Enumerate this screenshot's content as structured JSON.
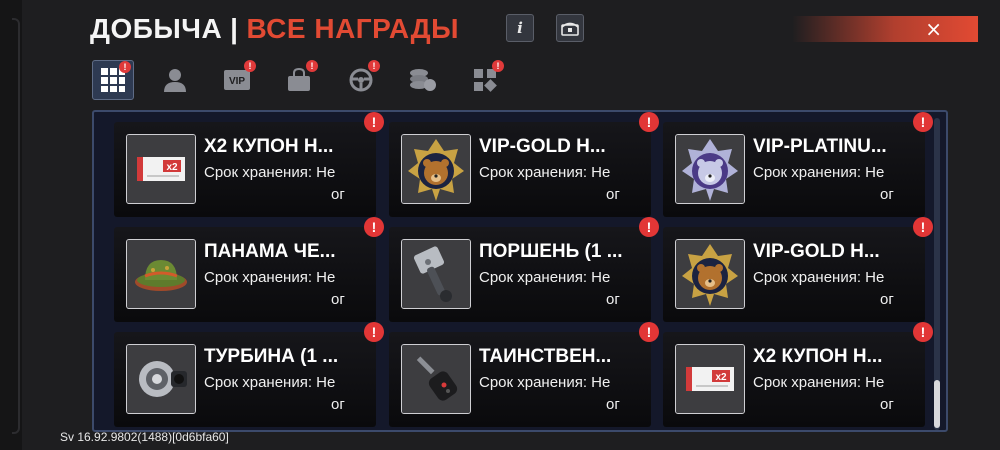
{
  "header": {
    "title_main": "ДОБЫЧА",
    "title_sep": "|",
    "title_accent": "ВСЕ НАГРАДЫ",
    "info_button_label": "i",
    "close_label": "×",
    "accent_color": "#e24a33"
  },
  "tabs": [
    {
      "icon": "grid-icon",
      "active": true,
      "badge": "!"
    },
    {
      "icon": "person-icon",
      "active": false,
      "badge": ""
    },
    {
      "icon": "vip-icon",
      "label": "VIP",
      "active": false,
      "badge": "!"
    },
    {
      "icon": "bag-icon",
      "active": false,
      "badge": "!"
    },
    {
      "icon": "steering-wheel-icon",
      "active": false,
      "badge": "!"
    },
    {
      "icon": "coins-icon",
      "active": false,
      "badge": ""
    },
    {
      "icon": "apps-icon",
      "active": false,
      "badge": "!"
    }
  ],
  "items": [
    {
      "name": "X2 КУПОН Н...",
      "storage": "Срок хранения: Не",
      "storage_cont": "ог",
      "icon": "x2-coupon-icon",
      "badge": "!"
    },
    {
      "name": "VIP-GOLD Н...",
      "storage": "Срок хранения: Не",
      "storage_cont": "ог",
      "icon": "vip-gold-bear-icon",
      "badge": "!"
    },
    {
      "name": "VIP-PLATINU...",
      "storage": "Срок хранения: Не",
      "storage_cont": "ог",
      "icon": "vip-platinum-bear-icon",
      "badge": "!"
    },
    {
      "name": "ПАНАМА ЧЕ...",
      "storage": "Срок хранения: Не",
      "storage_cont": "ог",
      "icon": "panama-hat-icon",
      "badge": "!"
    },
    {
      "name": "ПОРШЕНЬ (1 ...",
      "storage": "Срок хранения: Не",
      "storage_cont": "ог",
      "icon": "piston-icon",
      "badge": "!"
    },
    {
      "name": "VIP-GOLD Н...",
      "storage": "Срок хранения: Не",
      "storage_cont": "ог",
      "icon": "vip-gold-bear-icon",
      "badge": "!"
    },
    {
      "name": "ТУРБИНА (1 ...",
      "storage": "Срок хранения: Не",
      "storage_cont": "ог",
      "icon": "turbine-icon",
      "badge": "!"
    },
    {
      "name": "ТАИНСТВЕН...",
      "storage": "Срок хранения: Не",
      "storage_cont": "ог",
      "icon": "car-key-icon",
      "badge": "!"
    },
    {
      "name": "X2 КУПОН Н...",
      "storage": "Срок хранения: Не",
      "storage_cont": "ог",
      "icon": "x2-coupon-icon",
      "badge": "!"
    }
  ],
  "coupon_text": "x2",
  "version": "Sv 16.92.9802(1488)[0d6bfa60]"
}
